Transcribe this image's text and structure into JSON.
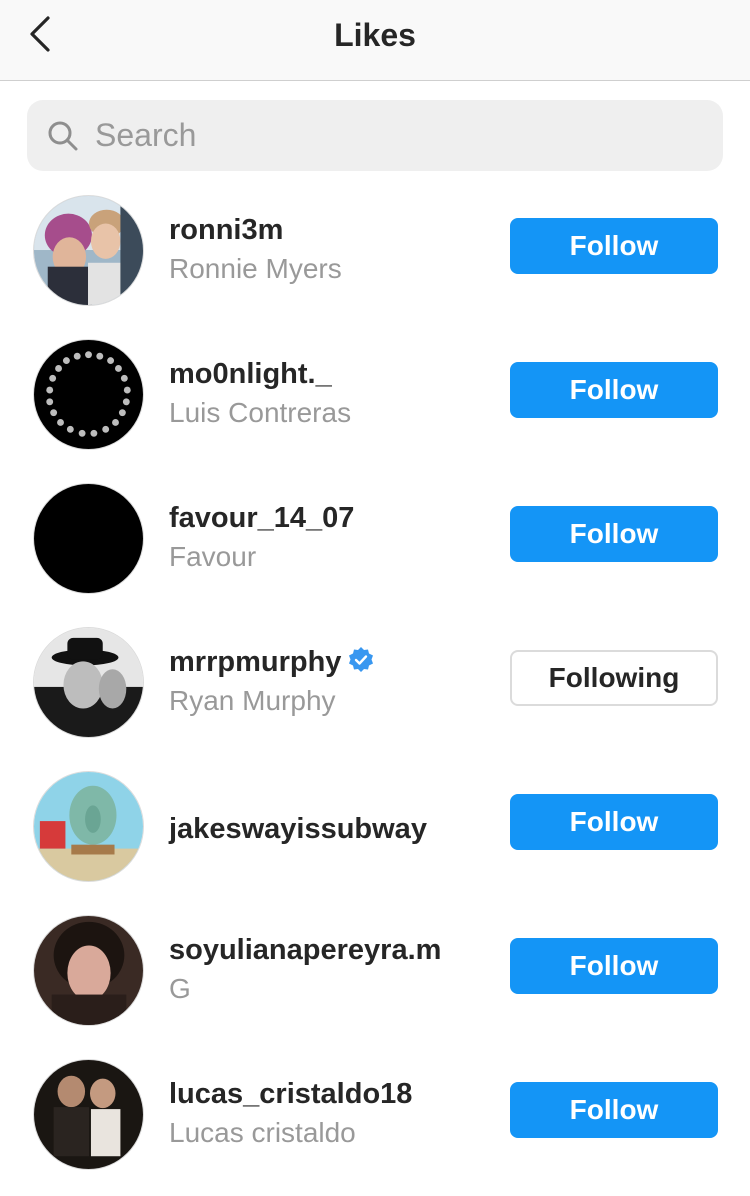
{
  "header": {
    "back_icon": "chevron-left-icon",
    "title": "Likes"
  },
  "search": {
    "icon": "search-icon",
    "placeholder": "Search",
    "value": ""
  },
  "accent_color": "#1495f6",
  "verified_color": "#3897f0",
  "users": [
    {
      "username": "ronni3m",
      "full_name": "Ronnie Myers",
      "verified": false,
      "button": "Follow"
    },
    {
      "username": "mo0nlight._",
      "full_name": "Luis Contreras",
      "verified": false,
      "button": "Follow"
    },
    {
      "username": "favour_14_07",
      "full_name": "Favour",
      "verified": false,
      "button": "Follow"
    },
    {
      "username": "mrrpmurphy",
      "full_name": "Ryan Murphy",
      "verified": true,
      "button": "Following"
    },
    {
      "username": "jakeswayissubway",
      "full_name": "",
      "verified": false,
      "button": "Follow"
    },
    {
      "username": "soyulianapereyra.m",
      "full_name": "G",
      "verified": false,
      "button": "Follow"
    },
    {
      "username": "lucas_cristaldo18",
      "full_name": "Lucas cristaldo",
      "verified": false,
      "button": "Follow"
    }
  ]
}
